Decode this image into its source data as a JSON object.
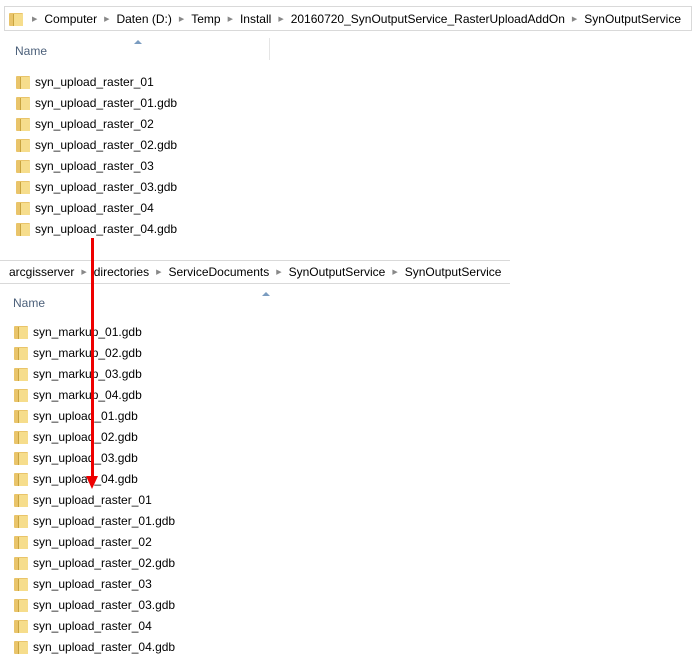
{
  "top": {
    "breadcrumb": [
      "Computer",
      "Daten (D:)",
      "Temp",
      "Install",
      "20160720_SynOutputService_RasterUploadAddOn",
      "SynOutputService"
    ],
    "column_header": "Name",
    "items": [
      "syn_upload_raster_01",
      "syn_upload_raster_01.gdb",
      "syn_upload_raster_02",
      "syn_upload_raster_02.gdb",
      "syn_upload_raster_03",
      "syn_upload_raster_03.gdb",
      "syn_upload_raster_04",
      "syn_upload_raster_04.gdb"
    ]
  },
  "bottom": {
    "breadcrumb": [
      "arcgisserver",
      "directories",
      "ServiceDocuments",
      "SynOutputService",
      "SynOutputService"
    ],
    "column_header": "Name",
    "items": [
      "syn_markup_01.gdb",
      "syn_markup_02.gdb",
      "syn_markup_03.gdb",
      "syn_markup_04.gdb",
      "syn_upload_01.gdb",
      "syn_upload_02.gdb",
      "syn_upload_03.gdb",
      "syn_upload_04.gdb",
      "syn_upload_raster_01",
      "syn_upload_raster_01.gdb",
      "syn_upload_raster_02",
      "syn_upload_raster_02.gdb",
      "syn_upload_raster_03",
      "syn_upload_raster_03.gdb",
      "syn_upload_raster_04",
      "syn_upload_raster_04.gdb"
    ]
  },
  "colors": {
    "arrow": "#ee0000",
    "header_text": "#4c607a"
  }
}
